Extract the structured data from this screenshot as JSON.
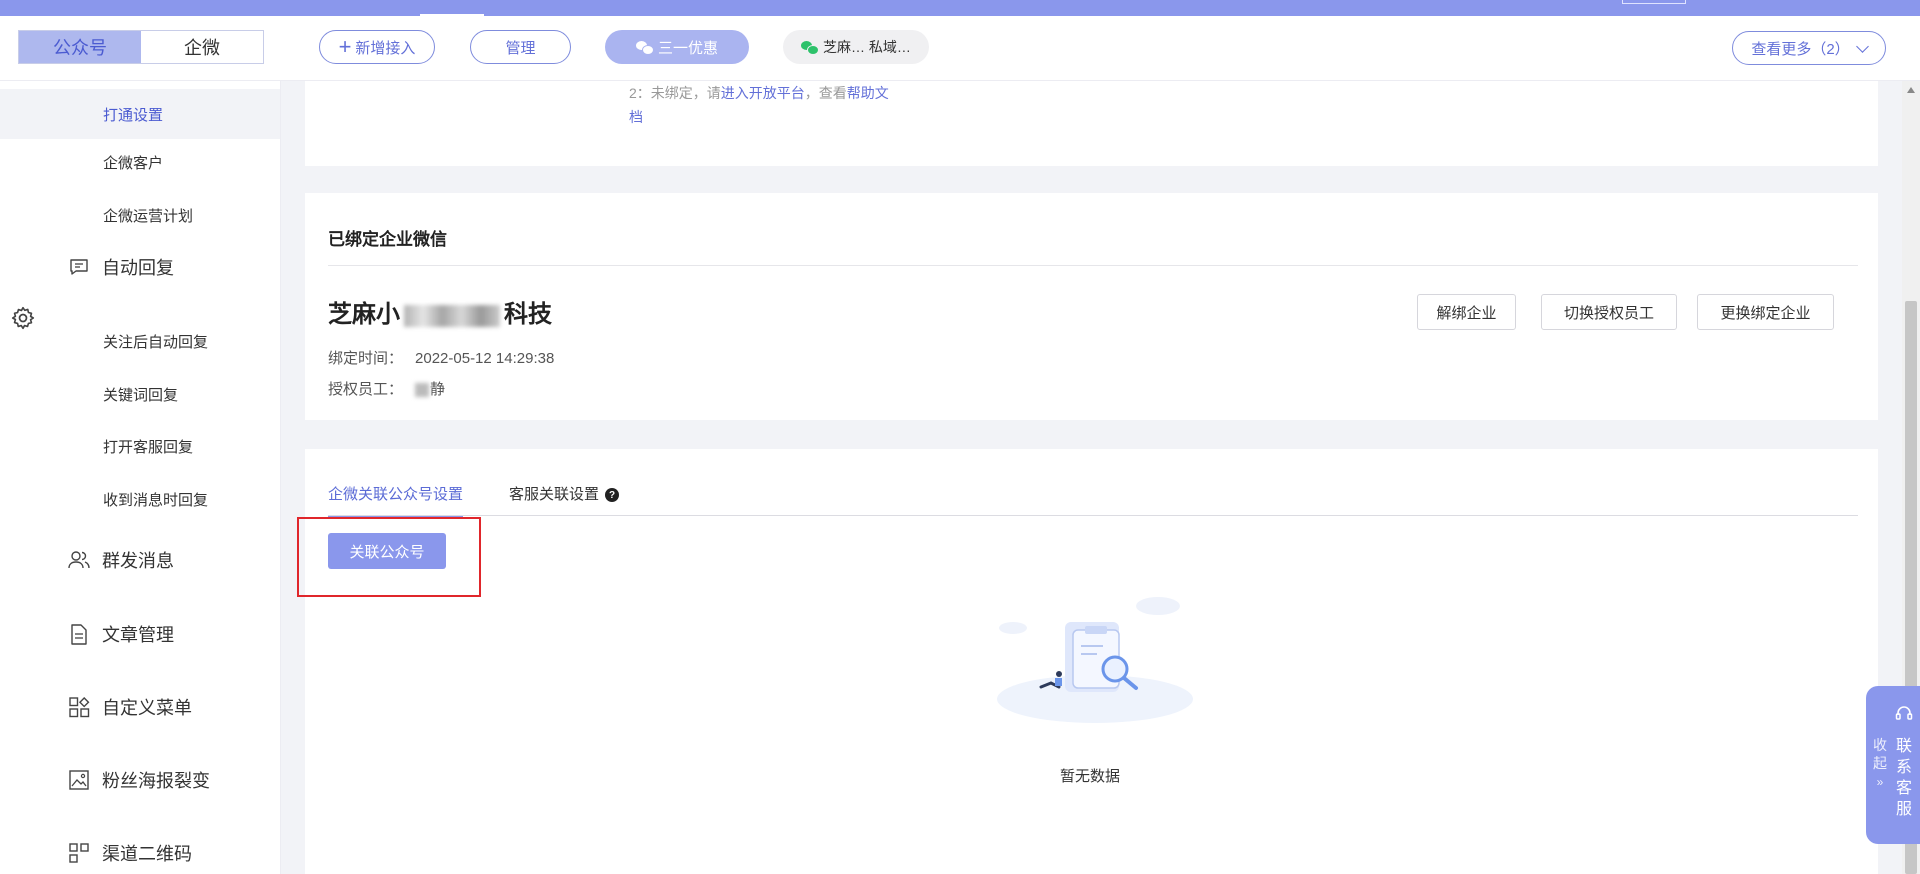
{
  "header": {
    "seg_left": "公众号",
    "seg_right": "企微",
    "add_label": "新增接入",
    "manage_label": "管理",
    "account1_label": "三一优惠",
    "account2_label": "芝麻… 私域…",
    "more_label": "查看更多（2）"
  },
  "sidebar": {
    "items": [
      {
        "label": "打通设置"
      },
      {
        "label": "企微客户"
      },
      {
        "label": "企微运营计划"
      },
      {
        "label": "自动回复"
      },
      {
        "label": "关注后自动回复"
      },
      {
        "label": "关键词回复"
      },
      {
        "label": "打开客服回复"
      },
      {
        "label": "收到消息时回复"
      },
      {
        "label": "群发消息"
      },
      {
        "label": "文章管理"
      },
      {
        "label": "自定义菜单"
      },
      {
        "label": "粉丝海报裂变"
      },
      {
        "label": "渠道二维码"
      }
    ]
  },
  "note": {
    "prefix": "2：未绑定，请",
    "link1": "进入开放平台",
    "mid": "，查看",
    "link2": "帮助文档"
  },
  "bound": {
    "title": "已绑定企业微信",
    "corp_prefix": "芝麻小",
    "corp_suffix": "科技",
    "bind_time_label": "绑定时间：",
    "bind_time_value": "2022-05-12 14:29:38",
    "staff_label": "授权员工：",
    "staff_value": "静",
    "unbind_label": "解绑企业",
    "switch_label": "切换授权员工",
    "change_label": "更换绑定企业"
  },
  "tabs": [
    {
      "label": "企微关联公众号设置"
    },
    {
      "label": "客服关联设置"
    }
  ],
  "assoc_button": "关联公众号",
  "empty_text": "暂无数据",
  "float": {
    "collapse": "收起",
    "contact": "联系客服"
  }
}
